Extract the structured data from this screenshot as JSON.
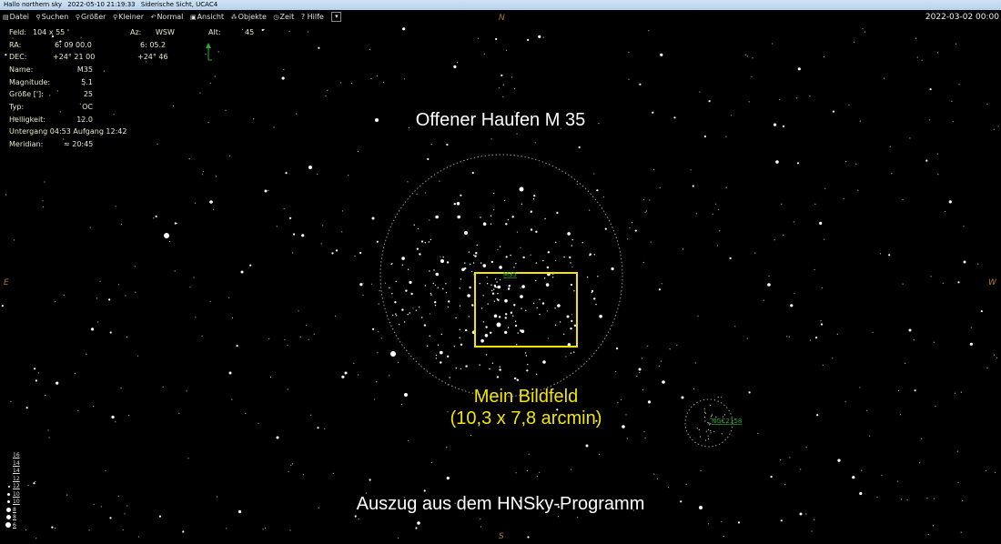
{
  "title_bar": {
    "app": "Hallo northern sky",
    "datetime": "2022-05-10  21:19:33",
    "view": "Siderische Sicht,  UCAC4"
  },
  "menu": [
    {
      "icon": "file-icon",
      "glyph": "▤",
      "label": "Datei"
    },
    {
      "icon": "binoculars-icon",
      "glyph": "⚲",
      "label": "Suchen"
    },
    {
      "icon": "zoom-in-icon",
      "glyph": "⚲",
      "label": "Größer"
    },
    {
      "icon": "zoom-out-icon",
      "glyph": "⚲",
      "label": "Kleiner"
    },
    {
      "icon": "undo-icon",
      "glyph": "↶",
      "label": "Normal"
    },
    {
      "icon": "monitor-icon",
      "glyph": "▣",
      "label": "Ansicht"
    },
    {
      "icon": "objects-icon",
      "glyph": "⁂",
      "label": "Objekte"
    },
    {
      "icon": "clock-icon",
      "glyph": "◷",
      "label": "Zeit"
    },
    {
      "icon": "help-icon",
      "glyph": "",
      "label": "? Hilfe"
    }
  ],
  "dropdown_glyph": "▾",
  "datetime_display": "2022-03-02  00:00",
  "info": {
    "feld_label": "Feld:",
    "feld_value": "104  x   55 '",
    "az_label": "Az:",
    "az_value": "WSW",
    "alt_label": "Alt:",
    "alt_value": "45",
    "ra_label": "RA:",
    "ra_value": "6: 09 00.0",
    "ra_value2": "6: 05.2",
    "dec_label": "DEC:",
    "dec_value": "+24° 21 00",
    "dec_value2": "+24° 46",
    "name_label": "Name:",
    "name_value": "M35",
    "mag_label": "Magnitude:",
    "mag_value": "5.1",
    "size_label": "Größe [']:",
    "size_value": "25",
    "type_label": "Typ:",
    "type_value": "OC",
    "bright_label": "Helligkeit:",
    "bright_value": "12.0",
    "setrise": "Untergang 04:53   Aufgang 12:42",
    "meridian_label": "Meridian:",
    "meridian_value": "≈ 20:45"
  },
  "annotations": {
    "title": "Offener Haufen M 35",
    "field_line1": "Mein Bildfeld",
    "field_line2": "(10,3 x 7,8 arcmin)",
    "source": "Auszug aus dem HNSky-Programm"
  },
  "objects": {
    "m35_label": "M35",
    "ngc_label": "NGC2158"
  },
  "compass": {
    "n": "N",
    "s": "S",
    "e": "E",
    "w": "W"
  },
  "legend": [
    "16",
    "14",
    "14",
    "12",
    "12",
    "10",
    "10",
    "8",
    "8",
    "6"
  ],
  "colors": {
    "label_green": "#2faa2f",
    "frame_yellow": "#f2e600",
    "compass_orange": "#b07a2a"
  }
}
